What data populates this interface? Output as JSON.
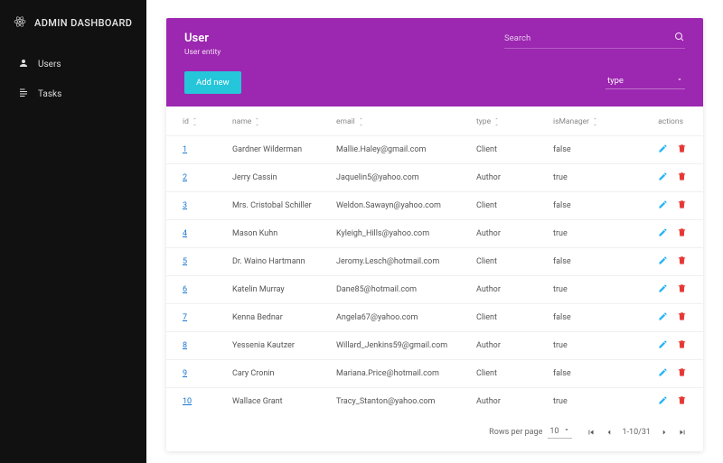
{
  "brand": {
    "title": "ADMIN DASHBOARD"
  },
  "nav": {
    "items": [
      {
        "label": "Users"
      },
      {
        "label": "Tasks"
      }
    ]
  },
  "header": {
    "title": "User",
    "subtitle": "User entity",
    "search_placeholder": "Search",
    "addnew": "Add new",
    "filter_label": "type"
  },
  "columns": {
    "id": "id",
    "name": "name",
    "email": "email",
    "type": "type",
    "isManager": "isManager",
    "actions": "actions"
  },
  "rows": [
    {
      "id": "1",
      "name": "Gardner Wilderman",
      "email": "Mallie.Haley@gmail.com",
      "type": "Client",
      "isManager": "false"
    },
    {
      "id": "2",
      "name": "Jerry Cassin",
      "email": "Jaquelin5@yahoo.com",
      "type": "Author",
      "isManager": "true"
    },
    {
      "id": "3",
      "name": "Mrs. Cristobal Schiller",
      "email": "Weldon.Sawayn@yahoo.com",
      "type": "Client",
      "isManager": "false"
    },
    {
      "id": "4",
      "name": "Mason Kuhn",
      "email": "Kyleigh_Hills@yahoo.com",
      "type": "Author",
      "isManager": "true"
    },
    {
      "id": "5",
      "name": "Dr. Waino Hartmann",
      "email": "Jeromy.Lesch@hotmail.com",
      "type": "Client",
      "isManager": "false"
    },
    {
      "id": "6",
      "name": "Katelin Murray",
      "email": "Dane85@hotmail.com",
      "type": "Author",
      "isManager": "true"
    },
    {
      "id": "7",
      "name": "Kenna Bednar",
      "email": "Angela67@yahoo.com",
      "type": "Client",
      "isManager": "false"
    },
    {
      "id": "8",
      "name": "Yessenia Kautzer",
      "email": "Willard_Jenkins59@gmail.com",
      "type": "Author",
      "isManager": "true"
    },
    {
      "id": "9",
      "name": "Cary Cronin",
      "email": "Mariana.Price@hotmail.com",
      "type": "Client",
      "isManager": "false"
    },
    {
      "id": "10",
      "name": "Wallace Grant",
      "email": "Tracy_Stanton@yahoo.com",
      "type": "Author",
      "isManager": "true"
    }
  ],
  "footer": {
    "rpp_label": "Rows per page",
    "rpp_value": "10",
    "range": "1-10/31"
  },
  "colors": {
    "accent": "#9c27b0",
    "addnew": "#26c6da",
    "edit": "#29b6f6",
    "delete": "#e53935"
  }
}
